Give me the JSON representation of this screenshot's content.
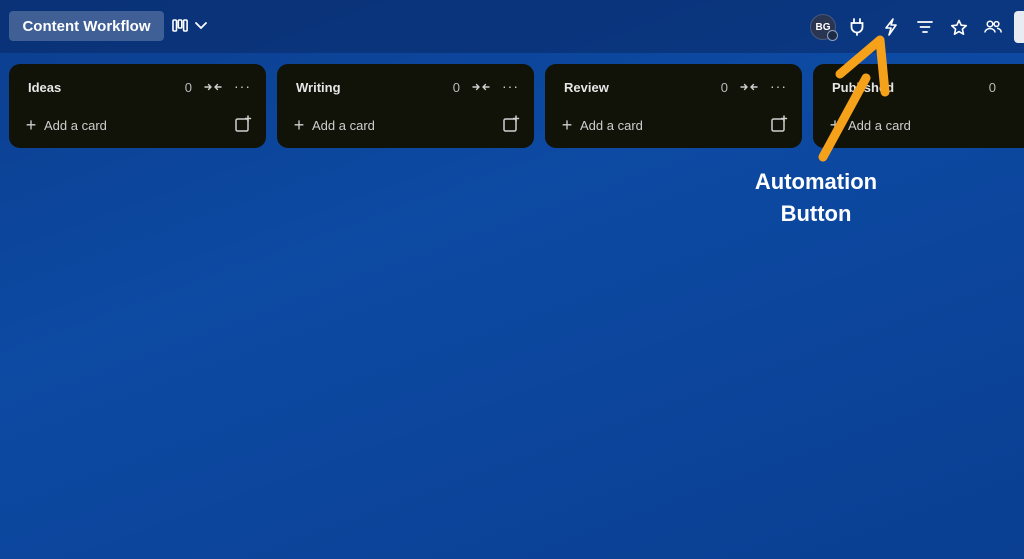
{
  "header": {
    "board_title": "Content Workflow",
    "avatar_initials": "BG"
  },
  "lists": [
    {
      "title": "Ideas",
      "count": "0",
      "add_label": "Add a card"
    },
    {
      "title": "Writing",
      "count": "0",
      "add_label": "Add a card"
    },
    {
      "title": "Review",
      "count": "0",
      "add_label": "Add a card"
    },
    {
      "title": "Published",
      "count": "0",
      "add_label": "Add a card"
    }
  ],
  "annotation": {
    "line1": "Automation",
    "line2": "Button",
    "color": "#f6a11a"
  },
  "icons": {
    "board_view": "board-view-icon",
    "chevron": "chevron-down-icon",
    "powerups": "plug-icon",
    "automation": "lightning-icon",
    "filter": "filter-icon",
    "star": "star-icon",
    "share": "members-icon"
  },
  "colors": {
    "background": "#0d4aa3",
    "list_bg": "#111208"
  }
}
